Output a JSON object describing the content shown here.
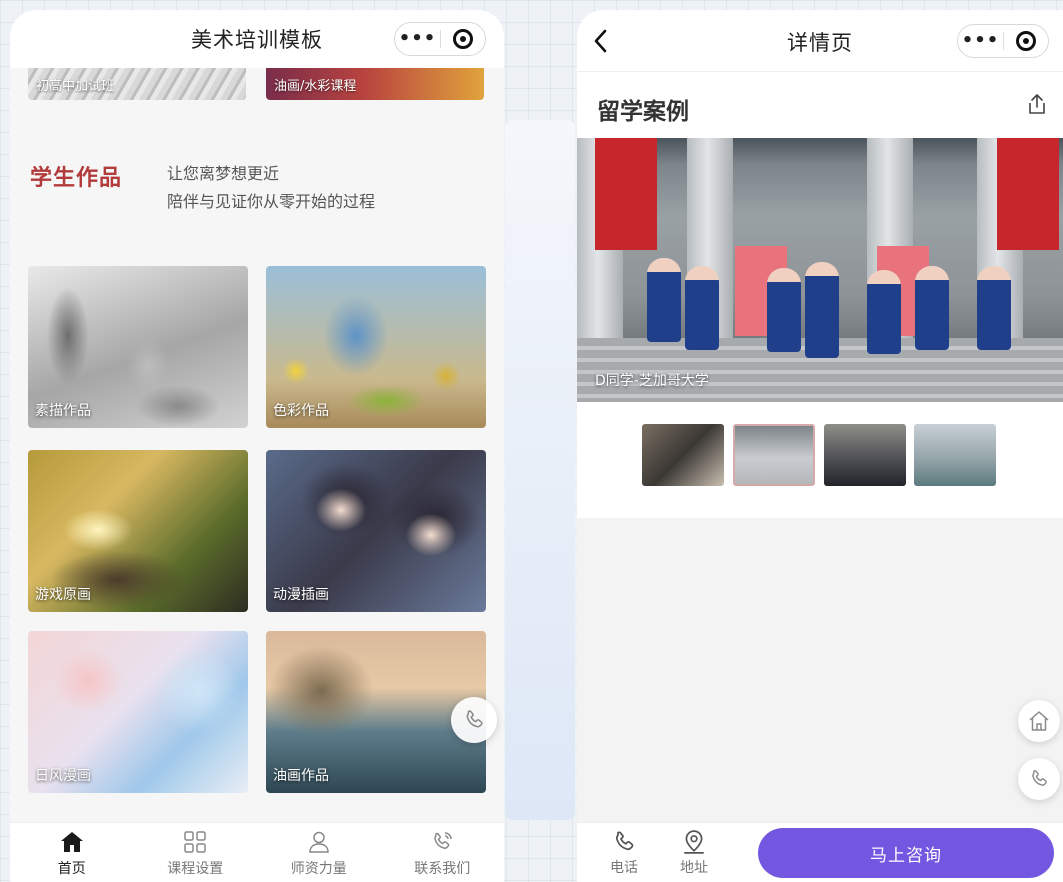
{
  "left": {
    "nav": {
      "title": "美术培训模板"
    },
    "courses": [
      {
        "label": "初高中加试班"
      },
      {
        "label": "油画/水彩课程"
      }
    ],
    "section": {
      "title": "学生作品",
      "desc_line1": "让您离梦想更近",
      "desc_line2": "陪伴与见证你从零开始的过程"
    },
    "works": [
      {
        "label": "素描作品"
      },
      {
        "label": "色彩作品"
      },
      {
        "label": "游戏原画"
      },
      {
        "label": "动漫插画"
      },
      {
        "label": "日风漫画"
      },
      {
        "label": "油画作品"
      }
    ],
    "tabs": [
      {
        "label": "首页",
        "icon": "home-icon",
        "active": true
      },
      {
        "label": "课程设置",
        "icon": "grid-icon"
      },
      {
        "label": "师资力量",
        "icon": "user-icon"
      },
      {
        "label": "联系我们",
        "icon": "phone-icon"
      }
    ]
  },
  "right": {
    "nav": {
      "title": "详情页"
    },
    "heading": "留学案例",
    "hero_caption": "D同学-芝加哥大学",
    "bottom": {
      "phone_label": "电话",
      "address_label": "地址",
      "consult_label": "马上咨询"
    }
  },
  "colors": {
    "accent_red": "#b23a3a",
    "consult_purple": "#7357e0"
  }
}
